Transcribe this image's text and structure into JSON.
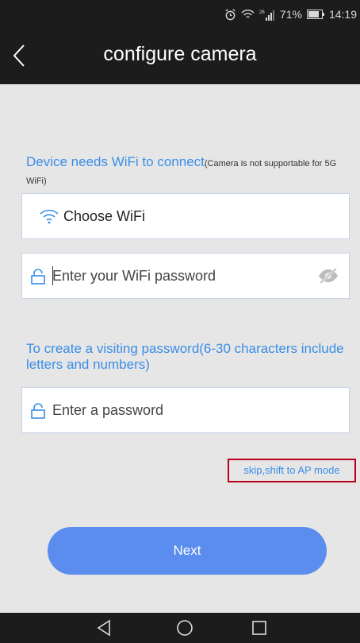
{
  "status_bar": {
    "battery": "71%",
    "time": "14:19",
    "signal_label": "26"
  },
  "header": {
    "title": "configure camera"
  },
  "wifi_section": {
    "heading": "Device needs WiFi to connect",
    "note": "(Camera is not supportable for 5G WiFi)",
    "choose_wifi_label": "Choose WiFi",
    "password_placeholder": "Enter your WiFi password"
  },
  "visit_section": {
    "heading": "To create a visiting password(6-30 characters include letters and numbers)",
    "password_placeholder": "Enter a password"
  },
  "skip_link": "skip,shift to AP mode",
  "next_button": "Next",
  "colors": {
    "accent": "#3a8ee6",
    "button": "#5b8def",
    "highlight": "#b8001b",
    "bar": "#1c1c1c"
  }
}
